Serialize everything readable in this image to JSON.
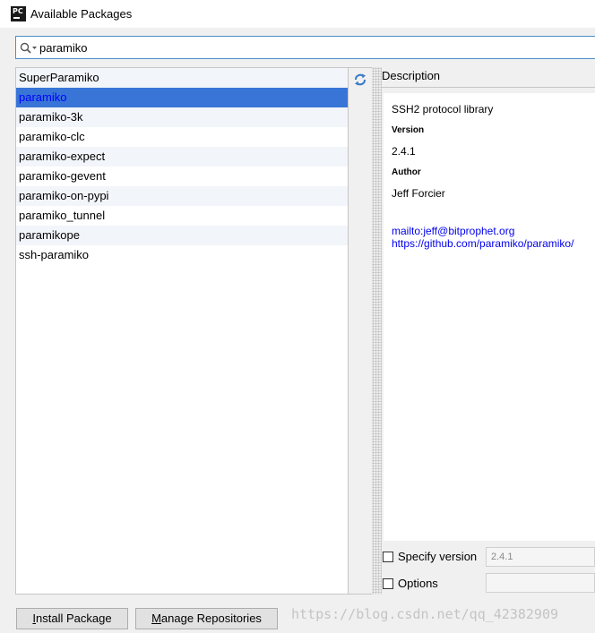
{
  "window": {
    "title": "Available Packages",
    "app_icon": "PC"
  },
  "search": {
    "value": "paramiko",
    "icon": "search-icon"
  },
  "packages": [
    "SuperParamiko",
    "paramiko",
    "paramiko-3k",
    "paramiko-clc",
    "paramiko-expect",
    "paramiko-gevent",
    "paramiko-on-pypi",
    "paramiko_tunnel",
    "paramikope",
    "ssh-paramiko"
  ],
  "selected_package": "paramiko",
  "description": {
    "header": "Description",
    "summary": "SSH2 protocol library",
    "version_label": "Version",
    "version": "2.4.1",
    "author_label": "Author",
    "author": "Jeff Forcier",
    "email_link": "mailto:jeff@bitprophet.org",
    "home_link": "https://github.com/paramiko/paramiko/"
  },
  "options": {
    "specify_version_label": "Specify version",
    "specify_version_value": "2.4.1",
    "options_label": "Options",
    "options_value": ""
  },
  "buttons": {
    "install_pre": "",
    "install_mnemonic": "I",
    "install_post": "nstall Package",
    "manage_pre": "",
    "manage_mnemonic": "M",
    "manage_post": "anage Repositories"
  },
  "watermark": "https://blog.csdn.net/qq_42382909",
  "colors": {
    "selection": "#3875d7",
    "link": "#0000ee",
    "search_border": "#4a90c8"
  }
}
